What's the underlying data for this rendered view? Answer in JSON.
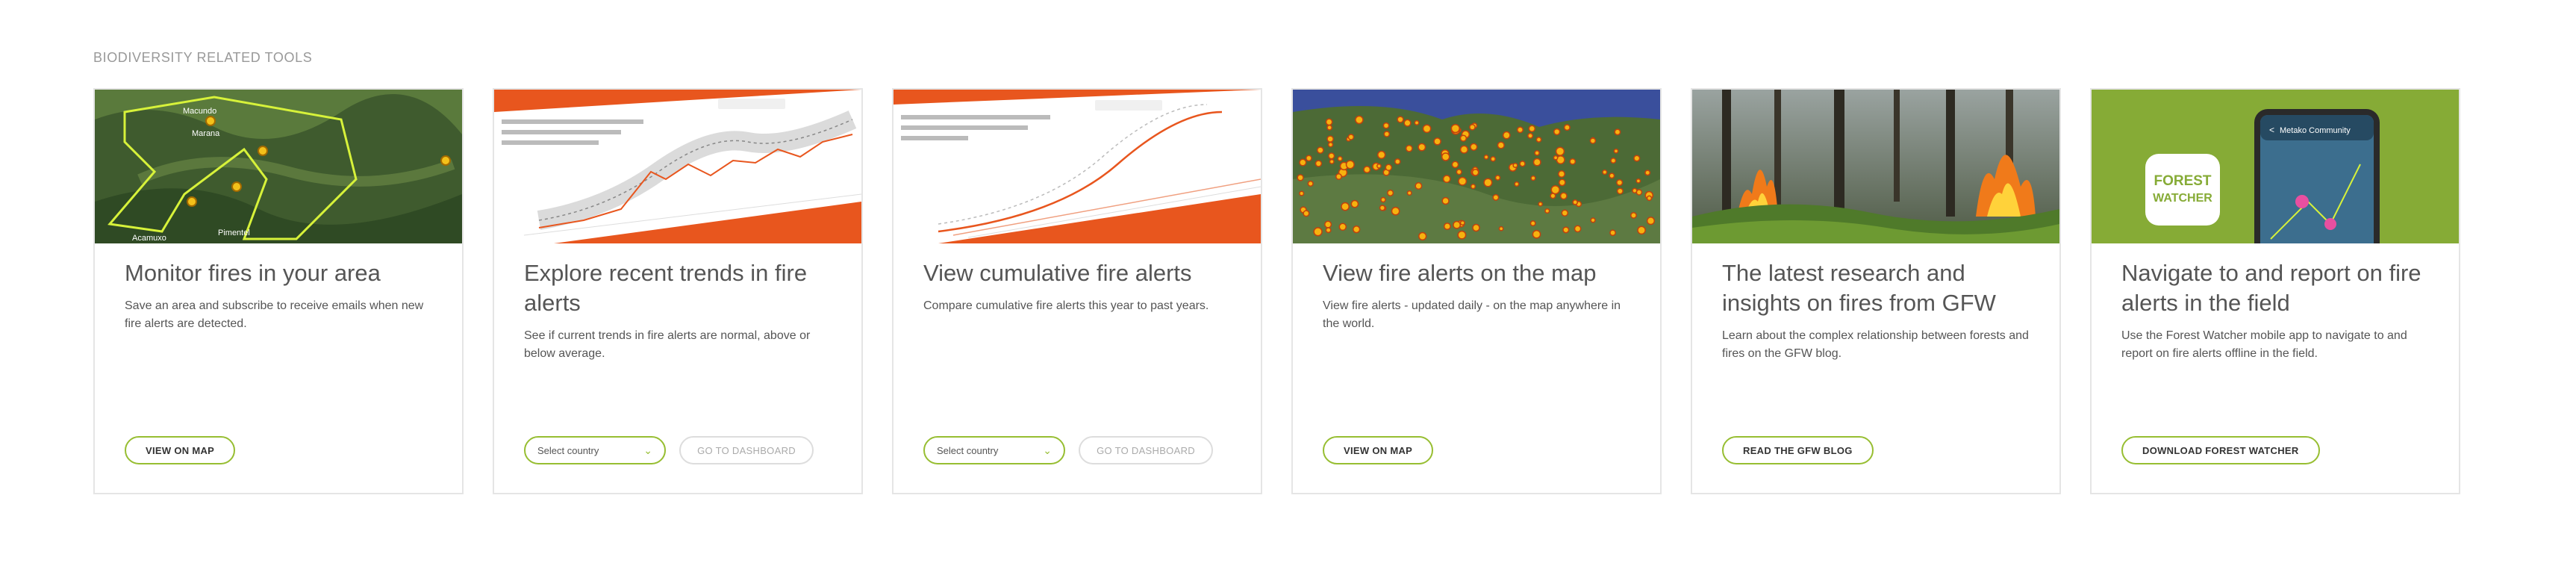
{
  "section": {
    "title": "Biodiversity related tools"
  },
  "colors": {
    "accent": "#97be32",
    "orange": "#e8561e",
    "border": "#e5e5e5"
  },
  "cards": [
    {
      "title": "Monitor fires in your area",
      "description": "Save an area and subscribe to receive emails when new fire alerts are detected.",
      "button": "VIEW ON MAP",
      "image": "satellite-map-with-area-outline",
      "map_labels": [
        "Macundo",
        "Marana",
        "Pimentel",
        "Acamuxo"
      ]
    },
    {
      "title": "Explore recent trends in fire alerts",
      "description": "See if current trends in fire alerts are normal, above or below average.",
      "select": "Select country",
      "button": "GO TO DASHBOARD",
      "image": "fire-trend-chart-preview"
    },
    {
      "title": "View cumulative fire alerts",
      "description": "Compare cumulative fire alerts this year to past years.",
      "select": "Select country",
      "button": "GO TO DASHBOARD",
      "image": "cumulative-fire-chart-preview"
    },
    {
      "title": "View fire alerts on the map",
      "description": "View fire alerts - updated daily - on the map anywhere in the world.",
      "button": "VIEW ON MAP",
      "image": "fire-alerts-satellite-map"
    },
    {
      "title": "The latest research and insights on fires from GFW",
      "description": "Learn about the complex relationship between forests and fires on the GFW blog.",
      "button": "READ THE GFW BLOG",
      "image": "forest-fire-photo"
    },
    {
      "title": "Navigate to and report on fire alerts in the field",
      "description": "Use the Forest Watcher mobile app to navigate to and report on fire alerts offline in the field.",
      "button": "DOWNLOAD FOREST WATCHER",
      "image": "forest-watcher-app",
      "logo_text": [
        "FOREST",
        "WATCHER"
      ],
      "phone_header": "Metako Community"
    }
  ]
}
